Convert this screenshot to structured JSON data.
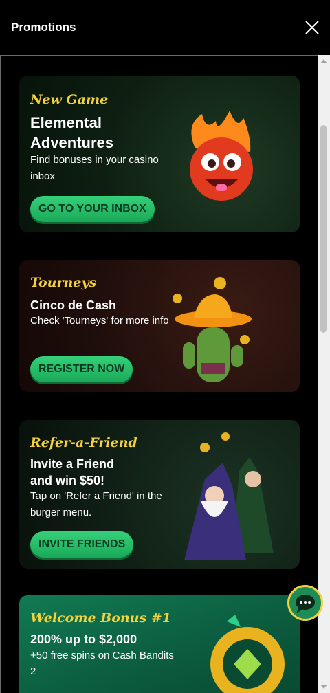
{
  "header": {
    "title": "Promotions"
  },
  "promotions": [
    {
      "kicker": "New Game",
      "headline_line1": "Elemental",
      "headline_line2": "Adventures",
      "desc_line1": "Find bonuses in your casino",
      "desc_line2": "inbox",
      "button": "GO TO YOUR INBOX"
    },
    {
      "kicker": "Tourneys",
      "headline": "Cinco de Cash",
      "desc": "Check 'Tourneys' for more info",
      "button": "REGISTER NOW"
    },
    {
      "kicker": "Refer-a-Friend",
      "headline_line1": "Invite a Friend",
      "headline_line2": "and win $50!",
      "desc_line1": "Tap on 'Refer a Friend' in the",
      "desc_line2": "burger menu.",
      "button": "INVITE FRIENDS"
    },
    {
      "kicker": "Welcome Bonus #1",
      "headline": "200% up to $2,000",
      "desc_line1": "+50 free spins on Cash Bandits",
      "desc_line2": "2"
    }
  ],
  "colors": {
    "accent_yellow": "#f3d23b",
    "button_green": "#35d07a",
    "chat_green": "#1f8c57"
  }
}
